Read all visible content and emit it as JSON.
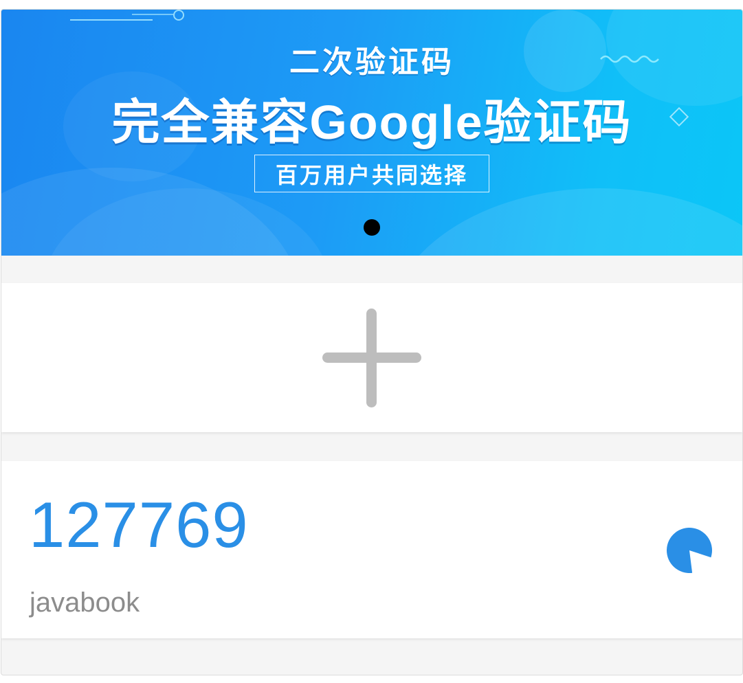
{
  "banner": {
    "subtitle": "二次验证码",
    "title": "完全兼容Google验证码",
    "badge": "百万用户共同选择",
    "carousel_active_index": 0,
    "carousel_count": 1
  },
  "add_button": {
    "icon": "plus-icon"
  },
  "token": {
    "code": "127769",
    "account": "javabook",
    "timer_icon": "countdown-pie-icon",
    "timer_remaining_fraction": 0.82
  },
  "colors": {
    "code": "#2a8fe6",
    "account": "#8c8c8c",
    "plus": "#bdbdbd",
    "timer": "#2a8fe6",
    "page_bg": "#f5f5f5"
  }
}
